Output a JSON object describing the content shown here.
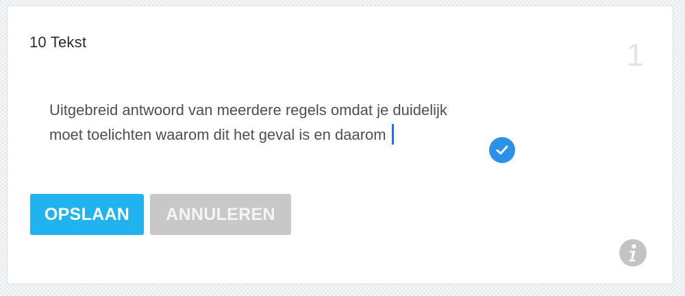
{
  "question": {
    "title": "10 Tekst",
    "number": "1"
  },
  "answer": {
    "value": "Uitgebreid antwoord van meerdere regels omdat je duidelijk moet toelichten waarom dit het geval is en daarom"
  },
  "buttons": {
    "save_label": "OPSLAAN",
    "cancel_label": "ANNULEREN"
  },
  "icons": {
    "status": "check-circle-icon",
    "info": "info-icon"
  },
  "colors": {
    "primary": "#21b2f0",
    "disabled": "#c8c8c8",
    "check": "#2a90e8",
    "caret": "#1e73e8"
  }
}
